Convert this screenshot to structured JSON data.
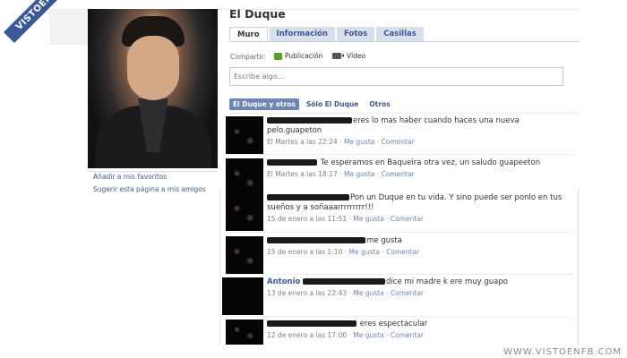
{
  "profile": {
    "name": "El Duque",
    "side_links": [
      "Añadir a mis favoritos",
      "Sugerir esta página a mis amigos"
    ]
  },
  "tabs": [
    "Muro",
    "Información",
    "Fotos",
    "Casillas"
  ],
  "share": {
    "label": "Compartir:",
    "publicacion": "Publicación",
    "video": "Vídeo",
    "placeholder": "Escribe algo..."
  },
  "filters": [
    "El Duque y otros",
    "Sólo El Duque",
    "Otros"
  ],
  "posts": [
    {
      "author": "",
      "text": "eres lo mas haber cuando haces una nueva pelo.guapeton",
      "time": "El Martes a las 22:24",
      "like": "Me gusta",
      "comment": "Comentar"
    },
    {
      "author": "",
      "text": "Te esperamos en Baqueira otra vez, un saludo guapeeton",
      "time": "El Martes a las 18:17",
      "like": "Me gusta",
      "comment": "Comentar"
    },
    {
      "author": "",
      "text": "Pon un Duque en tu vida. Y sino puede ser ponlo en tus sueños y a soñaaarrrrrrrrr!!!",
      "time": "15 de enero a las 11:51",
      "like": "Me gusta",
      "comment": "Comentar"
    },
    {
      "author": "",
      "text": "me gusta",
      "time": "15 de enero a las 1:10",
      "like": "Me gusta",
      "comment": "Comentar"
    },
    {
      "author": "Antonio",
      "text": "dice mi madre k ere muy guapo",
      "time": "13 de enero a las 22:43",
      "like": "Me gusta",
      "comment": "Comentar"
    },
    {
      "author": "",
      "text": "eres espectacular",
      "time": "12 de enero a las 17:00",
      "like": "Me gusta",
      "comment": "Comentar"
    }
  ],
  "meta_sep": " · ",
  "brand": {
    "badge": "VISTOENFB.COM",
    "watermark": "WWW.VISTOENFB.COM"
  }
}
